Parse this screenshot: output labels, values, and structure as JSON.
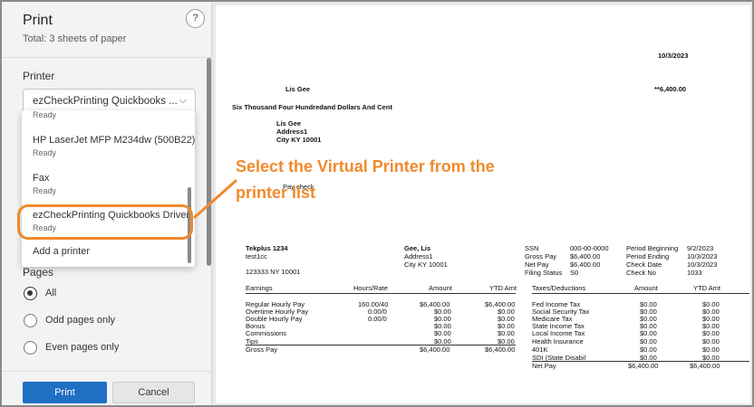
{
  "dialog": {
    "title": "Print",
    "subtitle": "Total: 3 sheets of paper",
    "help": "?"
  },
  "printer": {
    "label": "Printer",
    "selected": "ezCheckPrinting Quickbooks ...",
    "chevron": "⌵",
    "options": [
      {
        "name": "",
        "status": "Ready"
      },
      {
        "name": "HP LaserJet MFP M234dw (500B22)",
        "status": "Ready"
      },
      {
        "name": "Fax",
        "status": "Ready"
      },
      {
        "name": "ezCheckPrinting Quickbooks Driver",
        "status": "Ready"
      },
      {
        "name": "Add a printer",
        "status": ""
      }
    ]
  },
  "pages": {
    "label": "Pages",
    "options": [
      "All",
      "Odd pages only",
      "Even pages only"
    ]
  },
  "buttons": {
    "print": "Print",
    "cancel": "Cancel"
  },
  "annotation": {
    "line1": "Select the Virtual Printer from the",
    "line2": "printer list",
    "color": "#f08a2c"
  },
  "check": {
    "date": "10/3/2023",
    "payee": "Lis  Gee",
    "amount": "**6,400.00",
    "amount_words": "Six Thousand  Four Hundredand Dollars And  Cent",
    "address": [
      "Lis  Gee",
      "Address1",
      "City KY 10001"
    ],
    "memo": "Pay check",
    "company": {
      "name": "Tekplus 1234",
      "line1": "test1cc",
      "line2": "123333 NY 10001"
    },
    "employee": {
      "name": "Gee, Lis",
      "line1": "Address1",
      "line2": "City KY 10001"
    },
    "info_labels": [
      "SSN",
      "Gross Pay",
      "Net Pay",
      "Filing Status"
    ],
    "info_values": [
      "000-00-0000",
      "$6,400.00",
      "$6,400.00",
      "S0"
    ],
    "period_labels": [
      "Period Beginning",
      "Period Ending",
      "Check Date",
      "Check No"
    ],
    "period_values": [
      "9/2/2023",
      "10/3/2023",
      "10/3/2023",
      "1033"
    ],
    "earnings_headers": [
      "Earnings",
      "Hours/Rate",
      "Amount",
      "YTD Amt"
    ],
    "earnings": [
      [
        "Regular Hourly Pay",
        "160.00/40",
        "$6,400.00",
        "$6,400.00"
      ],
      [
        "Overtime Hourly Pay",
        "0.00/0",
        "$0.00",
        "$0.00"
      ],
      [
        "Double Hourly Pay",
        "0.00/0",
        "$0.00",
        "$0.00"
      ],
      [
        "Bonus",
        "",
        "$0.00",
        "$0.00"
      ],
      [
        "Commissions",
        "",
        "$0.00",
        "$0.00"
      ],
      [
        "Tips",
        "",
        "$0.00",
        "$0.00"
      ],
      [
        "Gross Pay",
        "",
        "$6,400.00",
        "$6,400.00"
      ]
    ],
    "tax_headers": [
      "Taxes/Deductions",
      "Amount",
      "YTD Amt"
    ],
    "taxes": [
      [
        "Fed Income Tax",
        "$0.00",
        "$0.00"
      ],
      [
        "Social Security Tax",
        "$0.00",
        "$0.00"
      ],
      [
        "Medicare Tax",
        "$0.00",
        "$0.00"
      ],
      [
        "State Income Tax",
        "$0.00",
        "$0.00"
      ],
      [
        "Local Income Tax",
        "$0.00",
        "$0.00"
      ],
      [
        "Health Insurance",
        "$0.00",
        "$0.00"
      ],
      [
        "401K",
        "$0.00",
        "$0.00"
      ],
      [
        "SDI (State Disabil",
        "$0.00",
        "$0.00"
      ],
      [
        "Net Pay",
        "$6,400.00",
        "$6,400.00"
      ]
    ]
  }
}
